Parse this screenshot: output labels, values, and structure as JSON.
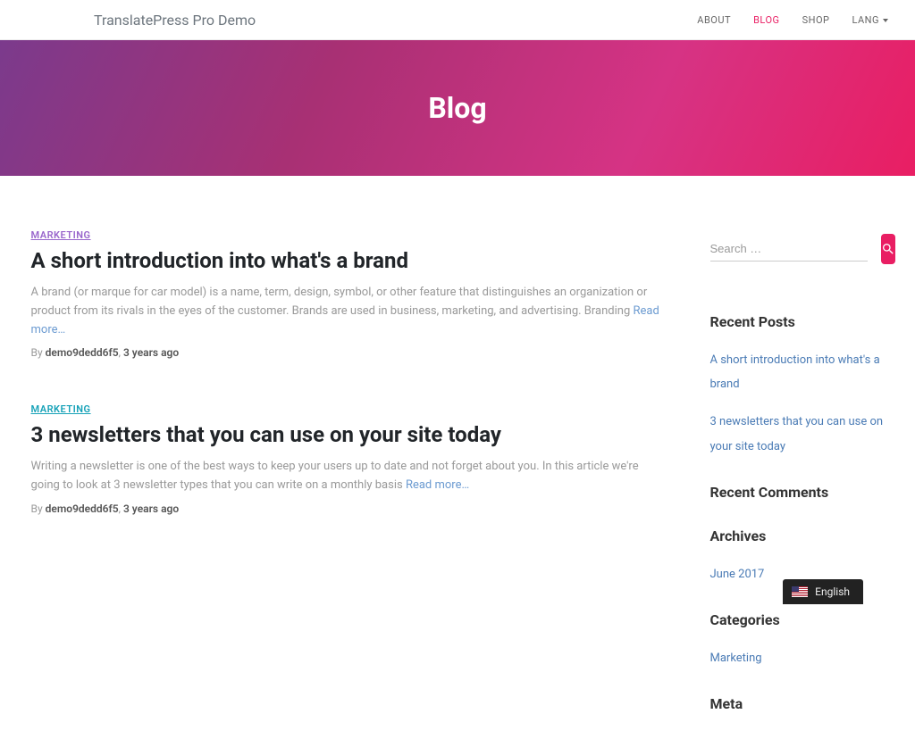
{
  "navbar": {
    "brand": "TranslatePress Pro Demo",
    "items": [
      {
        "label": "ABOUT",
        "active": false
      },
      {
        "label": "BLOG",
        "active": true
      },
      {
        "label": "SHOP",
        "active": false
      },
      {
        "label": "LANG",
        "active": false,
        "dropdown": true
      }
    ]
  },
  "hero": {
    "title": "Blog"
  },
  "posts": [
    {
      "category": "MARKETING",
      "categoryClass": "",
      "title": "A short introduction into what's a brand",
      "excerpt": "A brand (or marque for car model) is a name, term, design, symbol, or other feature that distinguishes an organization or product from its rivals in the eyes of the customer. Brands are used in business, marketing, and advertising. Branding",
      "readMore": "Read more…",
      "by": "By ",
      "author": "demo9dedd6f5",
      "sep": ", ",
      "date": "3 years ago"
    },
    {
      "category": "MARKETING",
      "categoryClass": "alt",
      "title": "3 newsletters that you can use on your site today",
      "excerpt": "Writing a newsletter is one of the best ways to keep your users up to date and not forget about you. In this article we're going to look at 3 newsletter types that you can write on a monthly basis ",
      "readMore": "Read more…",
      "by": "By ",
      "author": "demo9dedd6f5",
      "sep": ", ",
      "date": "3 years ago"
    }
  ],
  "search": {
    "placeholder": "Search …"
  },
  "widgets": {
    "recentPosts": {
      "title": "Recent Posts",
      "items": [
        {
          "label": "A short introduction into what's a brand"
        },
        {
          "label": "3 newsletters that you can use on your site today"
        }
      ]
    },
    "recentComments": {
      "title": "Recent Comments"
    },
    "archives": {
      "title": "Archives",
      "items": [
        {
          "label": "June 2017"
        }
      ]
    },
    "categories": {
      "title": "Categories",
      "items": [
        {
          "label": "Marketing"
        }
      ]
    },
    "meta": {
      "title": "Meta"
    }
  },
  "langSwitcher": {
    "label": "English"
  }
}
